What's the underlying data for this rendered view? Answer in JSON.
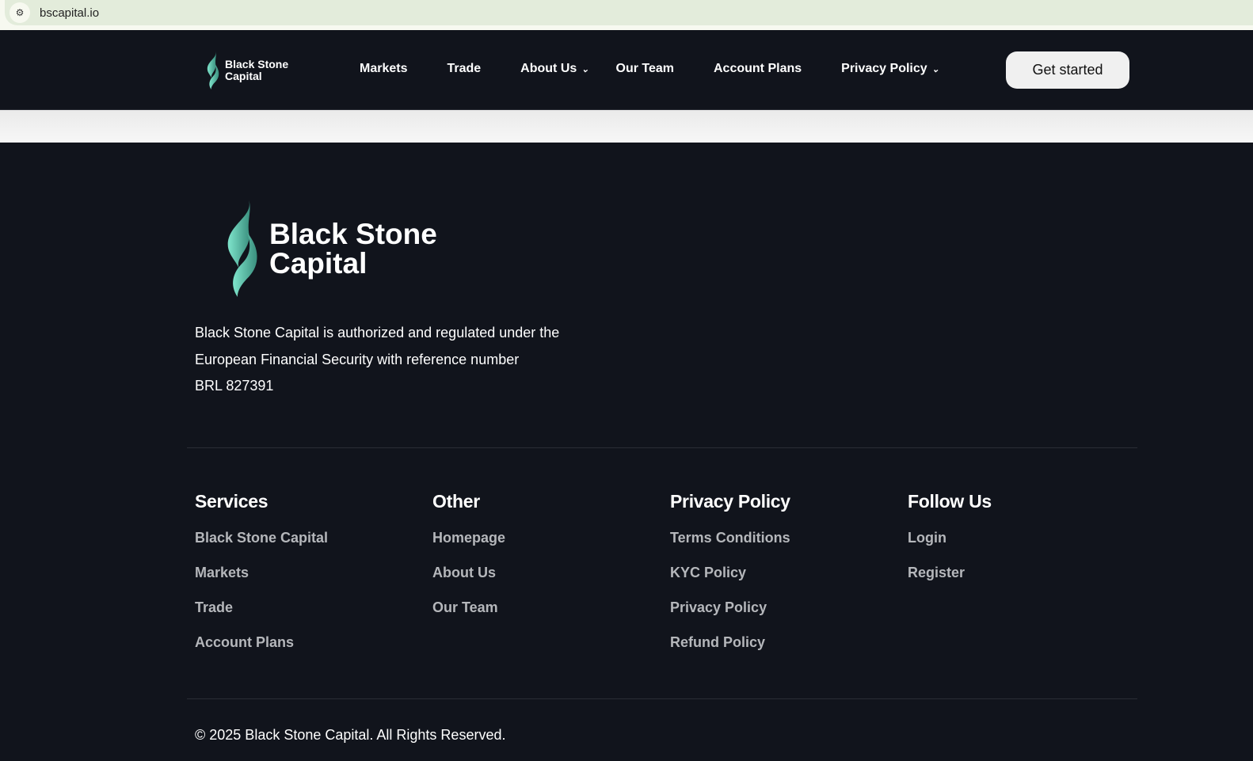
{
  "browser": {
    "url": "bscapital.io"
  },
  "brand": {
    "line1": "Black Stone",
    "line2": "Capital",
    "accent": "#6fd8c0"
  },
  "nav": {
    "items": [
      {
        "label": "Markets"
      },
      {
        "label": "Trade"
      },
      {
        "label": "About Us",
        "dropdown": true
      },
      {
        "label": "Our Team"
      },
      {
        "label": "Account Plans"
      },
      {
        "label": "Privacy Policy",
        "dropdown": true
      }
    ],
    "cta": "Get started"
  },
  "footer": {
    "about": [
      "Black Stone Capital is authorized and regulated under the",
      "European Financial Security with reference number",
      "BRL 827391"
    ],
    "columns": [
      {
        "title": "Services",
        "links": [
          "Black Stone Capital",
          "Markets",
          "Trade",
          "Account Plans"
        ]
      },
      {
        "title": "Other",
        "links": [
          "Homepage",
          "About Us",
          "Our Team"
        ]
      },
      {
        "title": "Privacy Policy",
        "links": [
          "Terms Conditions",
          "KYC Policy",
          "Privacy Policy",
          "Refund Policy"
        ]
      },
      {
        "title": "Follow Us",
        "links": [
          "Login",
          "Register"
        ]
      }
    ],
    "copyright": "© 2025 Black Stone Capital. All Rights Reserved."
  }
}
